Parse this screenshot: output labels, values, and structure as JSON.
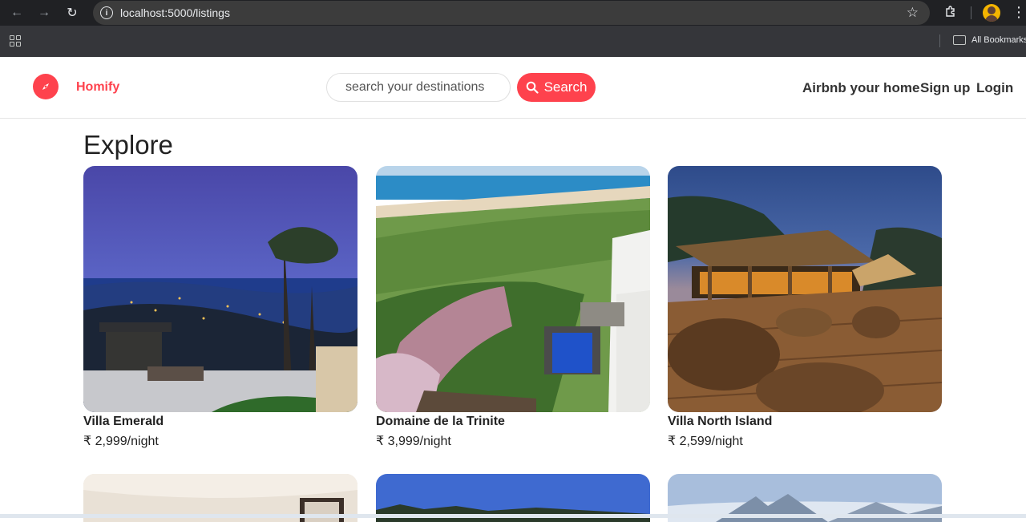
{
  "browser": {
    "url": "localhost:5000/listings",
    "bookmarks_label": "All Bookmarks"
  },
  "header": {
    "brand": "Homify",
    "search_placeholder": "search your destinations",
    "search_button": "Search",
    "nav": {
      "host": "Airbnb your home",
      "signup": "Sign up",
      "login": "Login"
    }
  },
  "colors": {
    "accent": "#fe424d"
  },
  "main": {
    "title": "Explore",
    "listings": [
      {
        "title": "Villa Emerald",
        "price": "₹ 2,999/night"
      },
      {
        "title": "Domaine de la Trinite",
        "price": "₹ 3,999/night"
      },
      {
        "title": "Villa North Island",
        "price": "₹ 2,599/night"
      }
    ]
  }
}
